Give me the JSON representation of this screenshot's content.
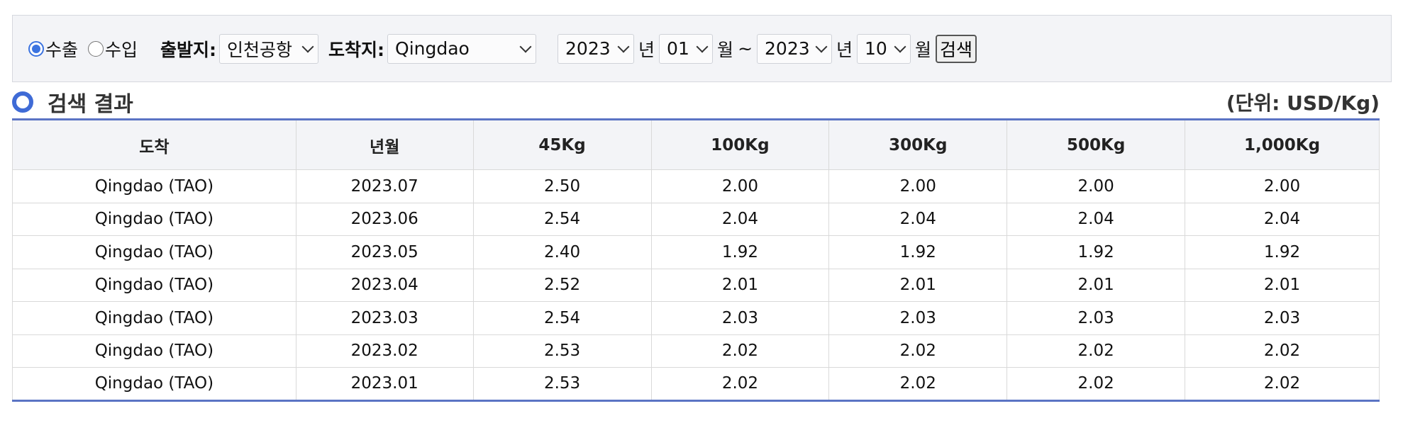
{
  "search": {
    "radios": [
      {
        "label": "수출",
        "checked": true
      },
      {
        "label": "수입",
        "checked": false
      }
    ],
    "origin_label": "출발지:",
    "origin_value": "인천공항",
    "dest_label": "도착지:",
    "dest_value": "Qingdao",
    "start_year": "2023",
    "start_month": "01",
    "end_year": "2023",
    "end_month": "10",
    "year_unit": "년",
    "month_unit": "월",
    "range_sep": "~",
    "button_label": "검색"
  },
  "results": {
    "title": "검색 결과",
    "unit": "(단위: USD/Kg)",
    "columns": [
      "도착",
      "년월",
      "45Kg",
      "100Kg",
      "300Kg",
      "500Kg",
      "1,000Kg"
    ],
    "rows": [
      [
        "Qingdao (TAO)",
        "2023.07",
        "2.50",
        "2.00",
        "2.00",
        "2.00",
        "2.00"
      ],
      [
        "Qingdao (TAO)",
        "2023.06",
        "2.54",
        "2.04",
        "2.04",
        "2.04",
        "2.04"
      ],
      [
        "Qingdao (TAO)",
        "2023.05",
        "2.40",
        "1.92",
        "1.92",
        "1.92",
        "1.92"
      ],
      [
        "Qingdao (TAO)",
        "2023.04",
        "2.52",
        "2.01",
        "2.01",
        "2.01",
        "2.01"
      ],
      [
        "Qingdao (TAO)",
        "2023.03",
        "2.54",
        "2.03",
        "2.03",
        "2.03",
        "2.03"
      ],
      [
        "Qingdao (TAO)",
        "2023.02",
        "2.53",
        "2.02",
        "2.02",
        "2.02",
        "2.02"
      ],
      [
        "Qingdao (TAO)",
        "2023.01",
        "2.53",
        "2.02",
        "2.02",
        "2.02",
        "2.02"
      ]
    ]
  },
  "colors": {
    "accent": "#3f6bd6",
    "table_border": "#5b74c4",
    "header_bg": "#f3f4f7"
  }
}
